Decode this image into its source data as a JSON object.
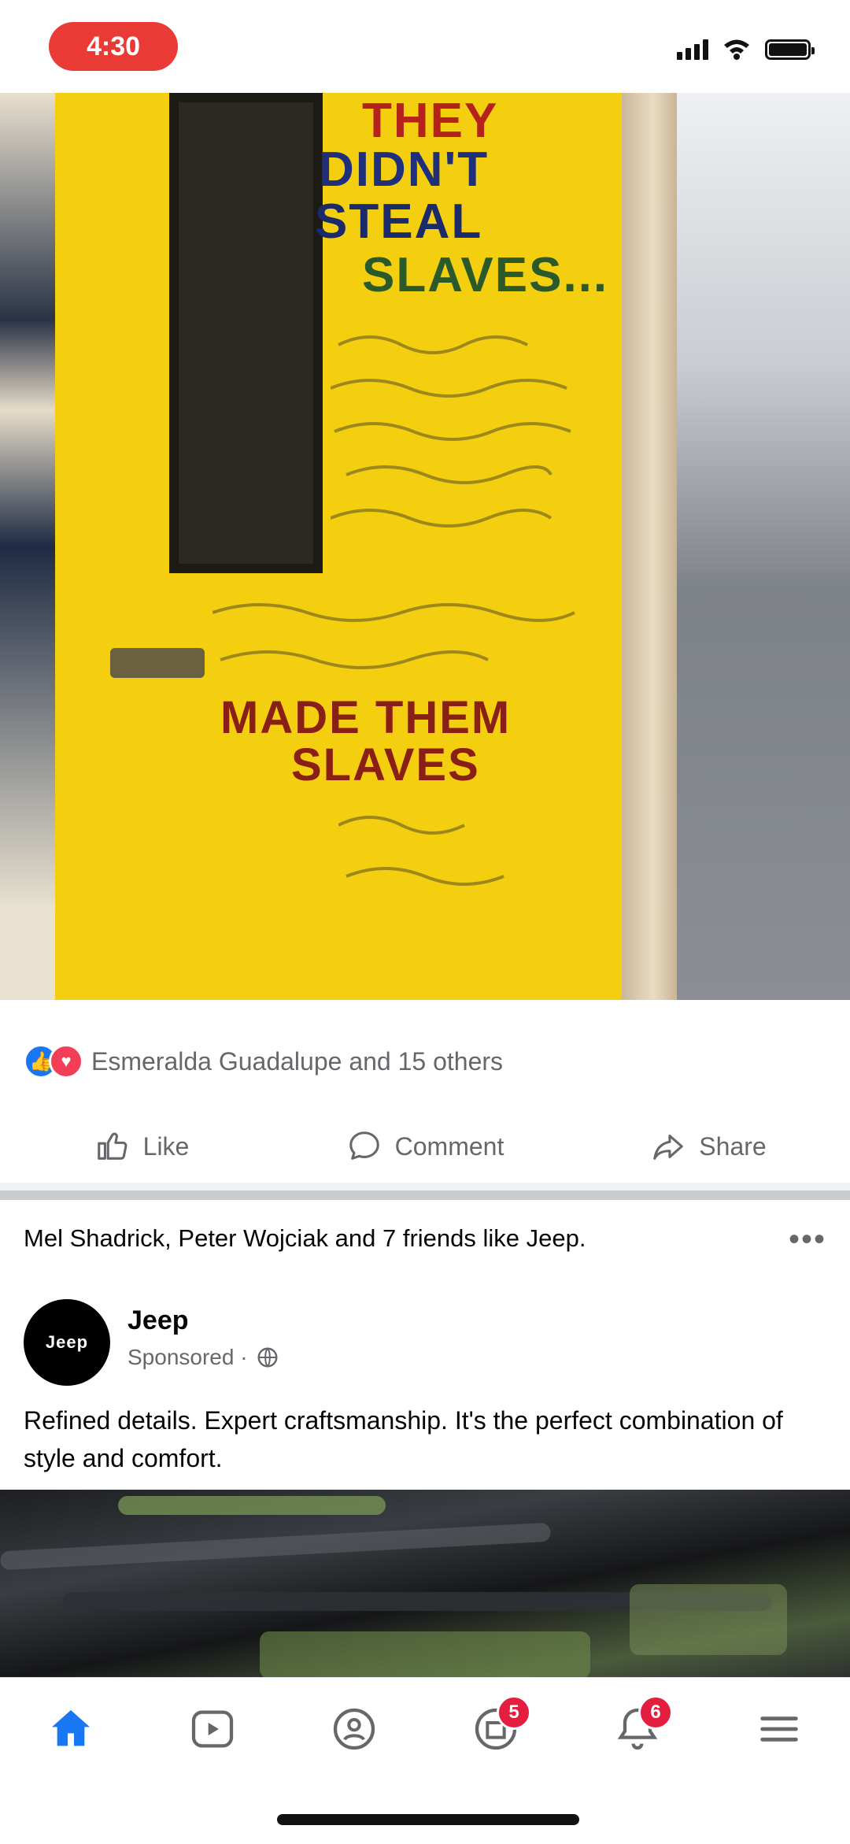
{
  "status_bar": {
    "time": "4:30"
  },
  "post1": {
    "photo_text": {
      "line1": "THEY",
      "line2": "DIDN'T",
      "line3": "STEAL",
      "line4": "SLAVES...",
      "line5": "MADE THEM",
      "line6": "SLAVES"
    },
    "reactions_text": "Esmeralda Guadalupe and 15 others",
    "actions": {
      "like": "Like",
      "comment": "Comment",
      "share": "Share"
    }
  },
  "post2": {
    "friends_like": "Mel Shadrick, Peter Wojciak and 7 friends like Jeep.",
    "more": "•••",
    "page_name": "Jeep",
    "avatar_logo": "Jeep",
    "sponsored": "Sponsored ·",
    "text": "Refined details. Expert craftsmanship. It's the perfect combination of style and comfort."
  },
  "tab_bar": {
    "items": [
      {
        "name": "home",
        "icon": "home-icon",
        "active": true
      },
      {
        "name": "watch",
        "icon": "watch-icon"
      },
      {
        "name": "groups",
        "icon": "groups-icon"
      },
      {
        "name": "marketplace",
        "icon": "marketplace-icon",
        "badge": "5"
      },
      {
        "name": "notifications",
        "icon": "bell-icon",
        "badge": "6"
      },
      {
        "name": "menu",
        "icon": "menu-icon"
      }
    ]
  },
  "colors": {
    "accent": "#1877f2",
    "badge": "#e41e3f",
    "time_pill": "#ea3a36",
    "door": "#f4cf10"
  }
}
